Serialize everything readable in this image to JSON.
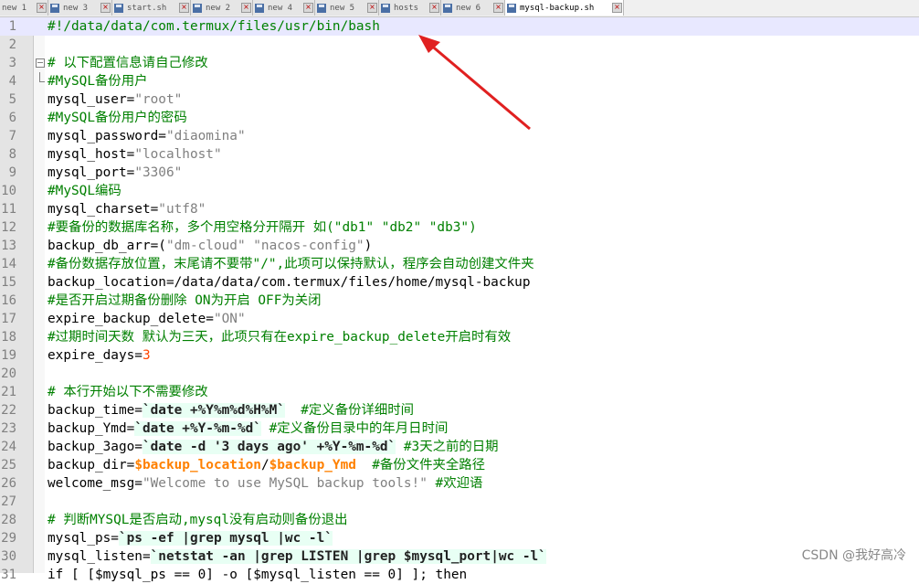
{
  "tabs": [
    {
      "label": "new 1",
      "width": 53,
      "active": false
    },
    {
      "label": "new 3",
      "width": 70,
      "active": false
    },
    {
      "label": "start.sh",
      "width": 86,
      "active": false
    },
    {
      "label": "new 2",
      "width": 68,
      "active": false
    },
    {
      "label": "new 4",
      "width": 68,
      "active": false
    },
    {
      "label": "new 5",
      "width": 70,
      "active": false
    },
    {
      "label": "hosts",
      "width": 68,
      "active": false
    },
    {
      "label": "new 6",
      "width": 70,
      "active": false
    },
    {
      "label": "mysql-backup.sh",
      "width": 130,
      "active": true
    }
  ],
  "lines": [
    [
      {
        "t": "#!/data/data/com.termux/files/usr/bin/bash",
        "c": "c"
      }
    ],
    [],
    [
      {
        "t": "# 以下配置信息请自己修改",
        "c": "c"
      }
    ],
    [
      {
        "t": "#MySQL备份用户",
        "c": "c"
      }
    ],
    [
      {
        "t": "mysql_user="
      },
      {
        "t": "\"root\"",
        "c": "s"
      }
    ],
    [
      {
        "t": "#MySQL备份用户的密码",
        "c": "c"
      }
    ],
    [
      {
        "t": "mysql_password="
      },
      {
        "t": "\"diaomina\"",
        "c": "s"
      }
    ],
    [
      {
        "t": "mysql_host="
      },
      {
        "t": "\"localhost\"",
        "c": "s"
      }
    ],
    [
      {
        "t": "mysql_port="
      },
      {
        "t": "\"3306\"",
        "c": "s"
      }
    ],
    [
      {
        "t": "#MySQL编码",
        "c": "c"
      }
    ],
    [
      {
        "t": "mysql_charset="
      },
      {
        "t": "\"utf8\"",
        "c": "s"
      }
    ],
    [
      {
        "t": "#要备份的数据库名称，多个用空格分开隔开 如(\"db1\" \"db2\" \"db3\")",
        "c": "c"
      }
    ],
    [
      {
        "t": "backup_db_arr=("
      },
      {
        "t": "\"dm-cloud\" \"nacos-config\"",
        "c": "s"
      },
      {
        "t": ")"
      }
    ],
    [
      {
        "t": "#备份数据存放位置，末尾请不要带\"/\",此项可以保持默认，程序会自动创建文件夹",
        "c": "c"
      }
    ],
    [
      {
        "t": "backup_location=/data/data/com.termux/files/home/mysql-backup"
      }
    ],
    [
      {
        "t": "#是否开启过期备份删除 ON为开启 OFF为关闭",
        "c": "c"
      }
    ],
    [
      {
        "t": "expire_backup_delete="
      },
      {
        "t": "\"ON\"",
        "c": "s"
      }
    ],
    [
      {
        "t": "#过期时间天数 默认为三天，此项只有在expire_backup_delete开启时有效",
        "c": "c"
      }
    ],
    [
      {
        "t": "expire_days="
      },
      {
        "t": "3",
        "c": "n"
      }
    ],
    [],
    [
      {
        "t": "# 本行开始以下不需要修改",
        "c": "c"
      }
    ],
    [
      {
        "t": "backup_time="
      },
      {
        "t": "`date +%Y%m%d%H%M`",
        "c": "bt"
      },
      {
        "t": "  "
      },
      {
        "t": "#定义备份详细时间",
        "c": "c"
      }
    ],
    [
      {
        "t": "backup_Ymd="
      },
      {
        "t": "`date +%Y-%m-%d`",
        "c": "bt"
      },
      {
        "t": " "
      },
      {
        "t": "#定义备份目录中的年月日时间",
        "c": "c"
      }
    ],
    [
      {
        "t": "backup_3ago="
      },
      {
        "t": "`date -d '3 days ago' +%Y-%m-%d`",
        "c": "bt"
      },
      {
        "t": " "
      },
      {
        "t": "#3天之前的日期",
        "c": "c"
      }
    ],
    [
      {
        "t": "backup_dir="
      },
      {
        "t": "$backup_location",
        "c": "v"
      },
      {
        "t": "/"
      },
      {
        "t": "$backup_Ymd",
        "c": "v"
      },
      {
        "t": "  "
      },
      {
        "t": "#备份文件夹全路径",
        "c": "c"
      }
    ],
    [
      {
        "t": "welcome_msg="
      },
      {
        "t": "\"Welcome to use MySQL backup tools!\"",
        "c": "s"
      },
      {
        "t": " "
      },
      {
        "t": "#欢迎语",
        "c": "c"
      }
    ],
    [],
    [
      {
        "t": "# 判断MYSQL是否启动,mysql没有启动则备份退出",
        "c": "c"
      }
    ],
    [
      {
        "t": "mysql_ps="
      },
      {
        "t": "`ps -ef |grep mysql |wc -l`",
        "c": "bt"
      }
    ],
    [
      {
        "t": "mysql_listen="
      },
      {
        "t": "`netstat -an |grep LISTEN |grep $mysql_port|wc -l`",
        "c": "bt"
      }
    ],
    [
      {
        "t": "if [ [$mysql_ps == 0] -o [$mysql_listen == 0] ]; then"
      }
    ]
  ],
  "watermark": "CSDN @我好高冷"
}
